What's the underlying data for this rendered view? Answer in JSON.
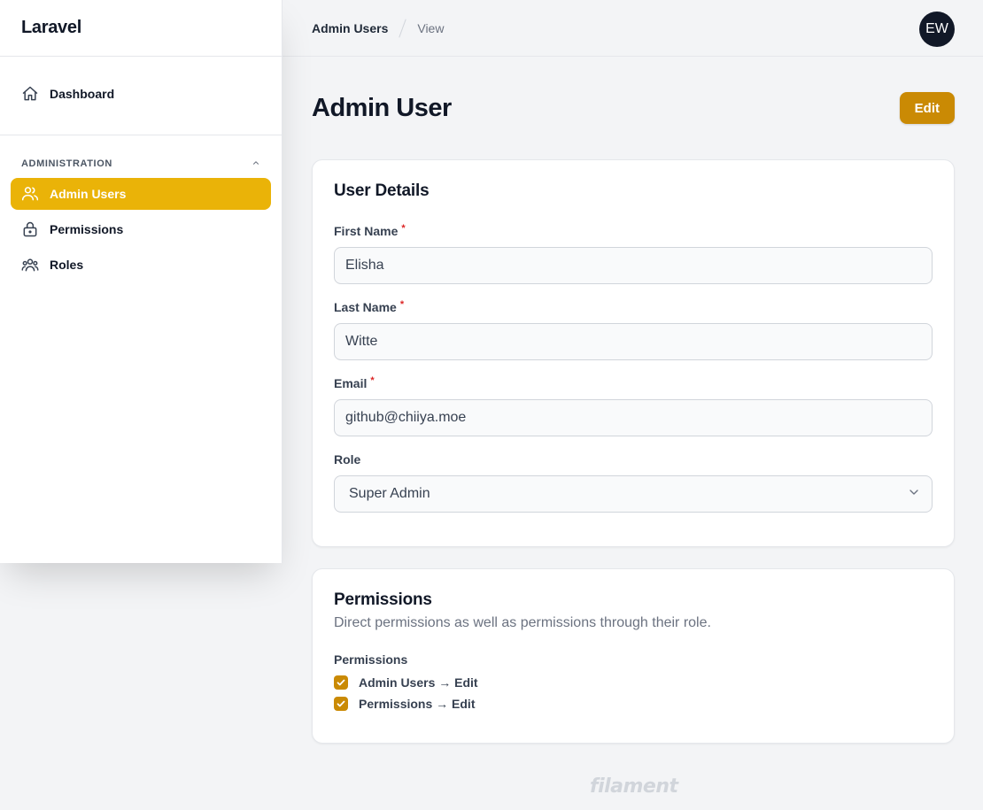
{
  "brand": {
    "name": "Laravel"
  },
  "sidebar": {
    "top_items": [
      {
        "label": "Dashboard",
        "icon": "home-icon"
      }
    ],
    "group": {
      "label": "ADMINISTRATION",
      "collapse_icon": "chevron-up-icon",
      "items": [
        {
          "label": "Admin Users",
          "icon": "users-icon",
          "active": true
        },
        {
          "label": "Permissions",
          "icon": "lock-icon",
          "active": false
        },
        {
          "label": "Roles",
          "icon": "user-group-icon",
          "active": false
        }
      ]
    }
  },
  "topbar": {
    "breadcrumb": [
      "Admin Users",
      "View"
    ],
    "avatar_initials": "EW"
  },
  "page": {
    "title": "Admin User",
    "edit_label": "Edit"
  },
  "user_details": {
    "title": "User Details",
    "first_name": {
      "label": "First Name",
      "required_mark": "*",
      "value": "Elisha"
    },
    "last_name": {
      "label": "Last Name",
      "required_mark": "*",
      "value": "Witte"
    },
    "email": {
      "label": "Email",
      "required_mark": "*",
      "value": "github@chiiya.moe"
    },
    "role": {
      "label": "Role",
      "value": "Super Admin"
    }
  },
  "permissions_card": {
    "title": "Permissions",
    "description": "Direct permissions as well as permissions through their role.",
    "list_label": "Permissions",
    "items": [
      {
        "label": "Admin Users → Edit",
        "checked": true
      },
      {
        "label": "Permissions → Edit",
        "checked": true
      }
    ]
  },
  "footer": {
    "logo_text": "filament"
  },
  "colors": {
    "accent": "#eab308",
    "button": "#ca8a04",
    "required": "#dc2626",
    "background": "#f3f4f6"
  }
}
